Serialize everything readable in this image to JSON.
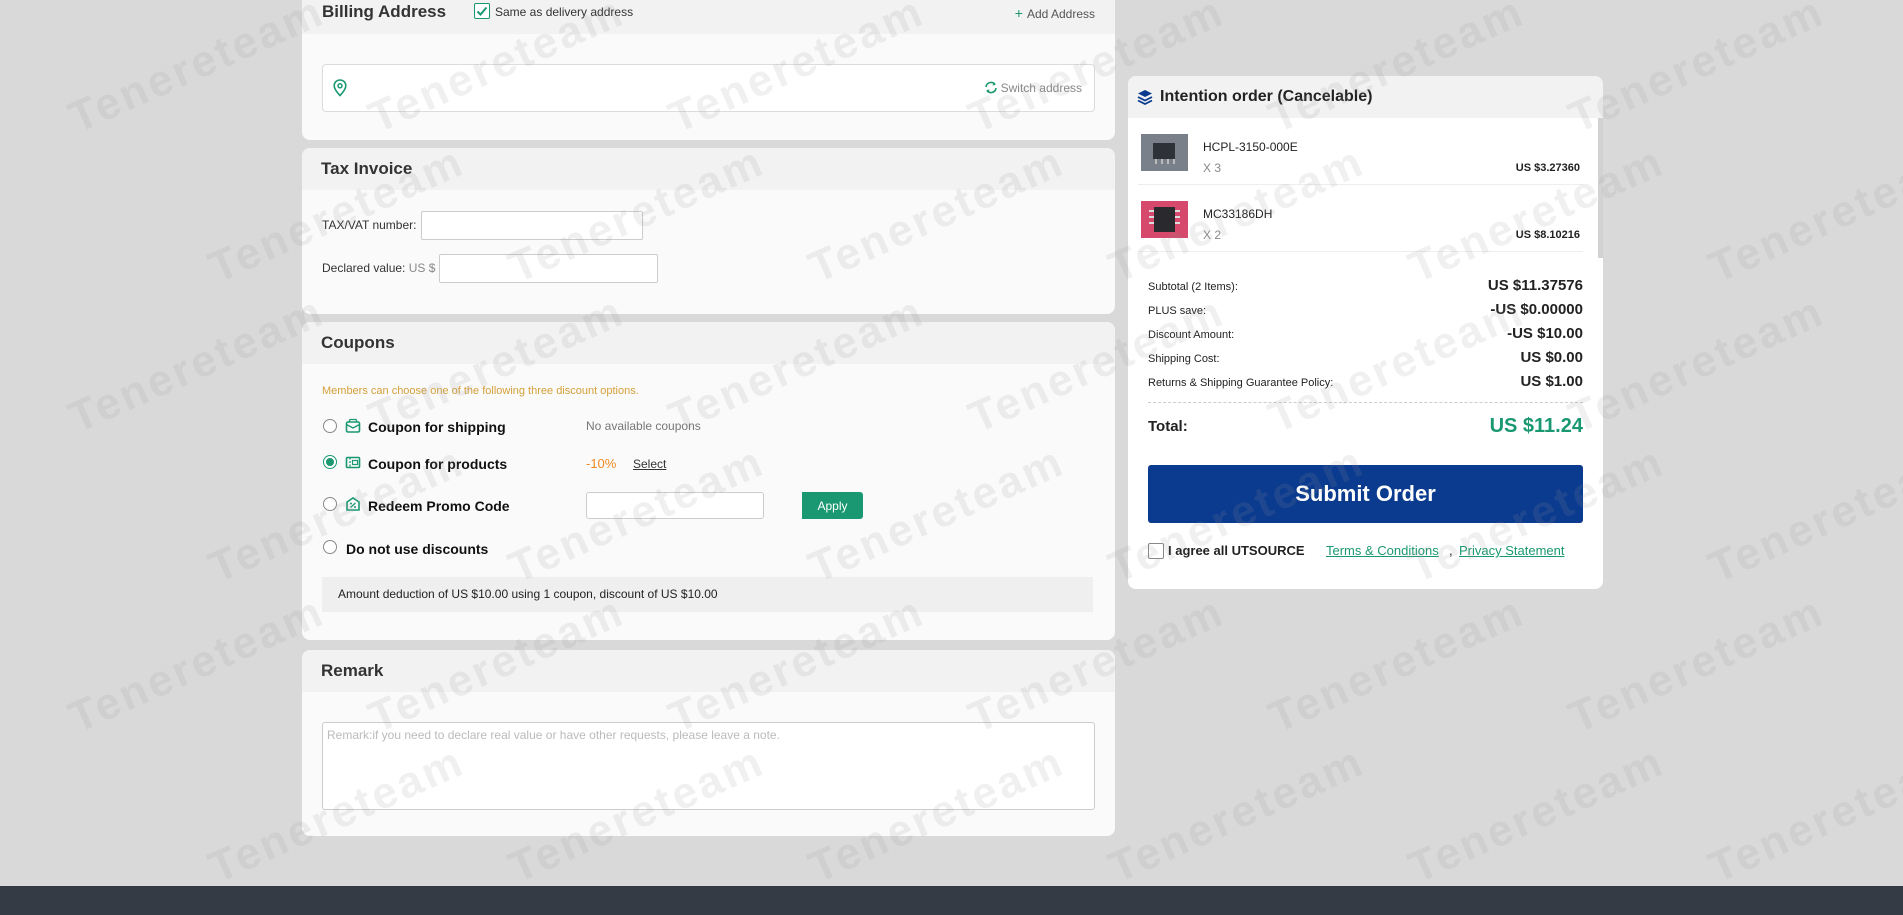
{
  "watermark": "Tenereteam",
  "billing": {
    "title": "Billing Address",
    "same_as_delivery": "Same as delivery address",
    "same_checked": true,
    "add_address": "Add Address",
    "add_icon": "+",
    "switch_address": "Switch address"
  },
  "tax": {
    "title": "Tax Invoice",
    "vat_label": "TAX/VAT number:",
    "vat_value": "",
    "declared_label": "Declared value:",
    "declared_unit": "US $",
    "declared_value": ""
  },
  "coupons": {
    "title": "Coupons",
    "note": "Members can choose one of the following three discount options.",
    "options": [
      {
        "label": "Coupon for shipping",
        "selected": false,
        "icon": "shipping-coupon-icon"
      },
      {
        "label": "Coupon for products",
        "selected": true,
        "icon": "product-coupon-icon"
      },
      {
        "label": "Redeem Promo Code",
        "selected": false,
        "icon": "promo-code-icon"
      },
      {
        "label": "Do not use discounts",
        "selected": false
      }
    ],
    "shipping_status": "No available coupons",
    "product_discount": "-10%",
    "select_label": "Select",
    "promo_placeholder": "",
    "apply_label": "Apply",
    "deduction_text": "Amount deduction of US $10.00 using 1 coupon, discount of US $10.00"
  },
  "remark": {
    "title": "Remark",
    "placeholder": "Remark:if you need to declare real value or have other requests, please leave a note."
  },
  "order": {
    "title": "Intention order (Cancelable)",
    "items": [
      {
        "name": "HCPL-3150-000E",
        "qty": "X 3",
        "price": "US $3.27360",
        "thumb_color": "#5e6470"
      },
      {
        "name": "MC33186DH",
        "qty": "X 2",
        "price": "US $8.10216",
        "thumb_color": "#d6486c"
      }
    ],
    "summary": [
      {
        "label": "Subtotal (2 Items):",
        "value": "US $11.37576"
      },
      {
        "label": "PLUS save:",
        "value": "-US $0.00000"
      },
      {
        "label": "Discount Amount:",
        "value": "-US $10.00"
      },
      {
        "label": "Shipping Cost:",
        "value": "US $0.00"
      },
      {
        "label": "Returns & Shipping Guarantee Policy:",
        "value": "US $1.00"
      }
    ],
    "total_label": "Total:",
    "total_value": "US $11.24",
    "submit_label": "Submit Order",
    "agree_checked": false,
    "agree_text": "I agree all UTSOURCE",
    "terms_link": "Terms & Conditions",
    "privacy_link": "Privacy Statement"
  },
  "colors": {
    "accent": "#1a9871",
    "submit": "#0b3b8f",
    "discount": "#f08a24",
    "note": "#d4a03a"
  }
}
